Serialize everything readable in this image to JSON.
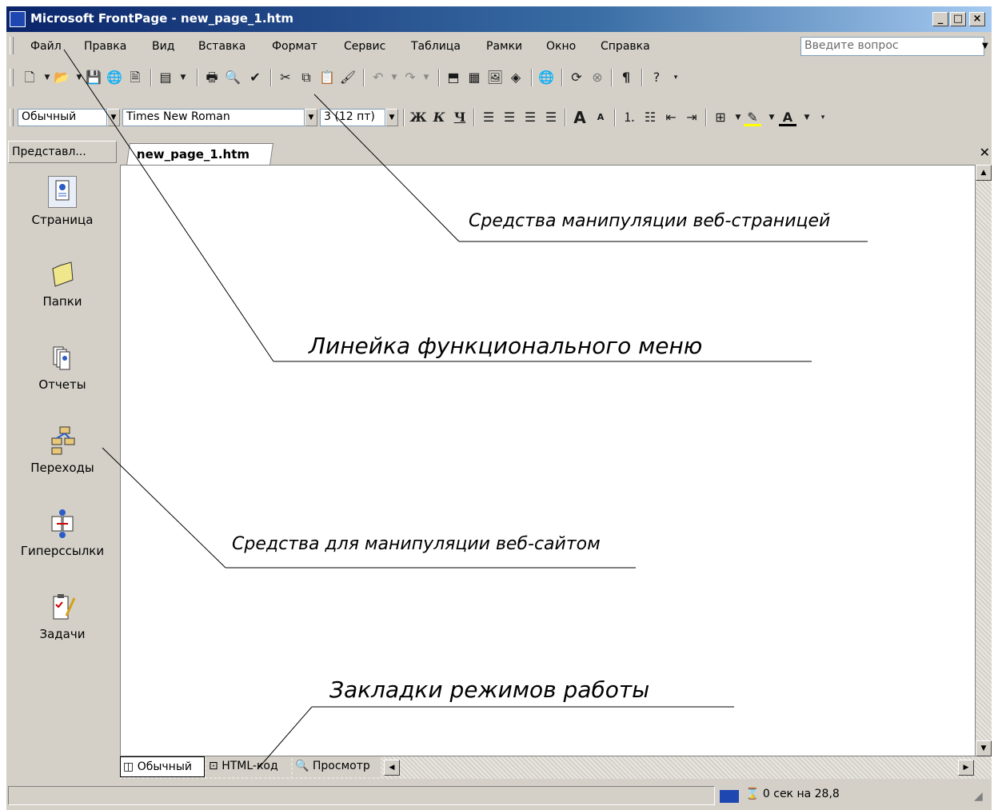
{
  "window": {
    "title": "Microsoft FrontPage - new_page_1.htm",
    "controls": [
      "_",
      "□",
      "×"
    ]
  },
  "menu": {
    "items": [
      "Файл",
      "Правка",
      "Вид",
      "Вставка",
      "Формат",
      "Сервис",
      "Таблица",
      "Рамки",
      "Окно",
      "Справка"
    ],
    "ask_placeholder": "Введите вопрос"
  },
  "formatting": {
    "style": "Обычный",
    "font": "Times New Roman",
    "size": "3 (12 пт)",
    "bold": "Ж",
    "italic": "К",
    "underline": "Ч"
  },
  "views_bar": {
    "header": "Представл...",
    "items": [
      "Страница",
      "Папки",
      "Отчеты",
      "Переходы",
      "Гиперссылки",
      "Задачи"
    ]
  },
  "document": {
    "tab": "new_page_1.htm"
  },
  "mode_tabs": [
    "Обычный",
    "HTML-код",
    "Просмотр"
  ],
  "status": {
    "timing": "0 сек на 28,8"
  },
  "annotations": {
    "page_tools": "Средства манипуляции веб-страницей",
    "menu_bar": "Линейка функционального меню",
    "site_tools": "Средства для манипуляции веб-сайтом",
    "mode_tabs": "Закладки режимов работы"
  }
}
